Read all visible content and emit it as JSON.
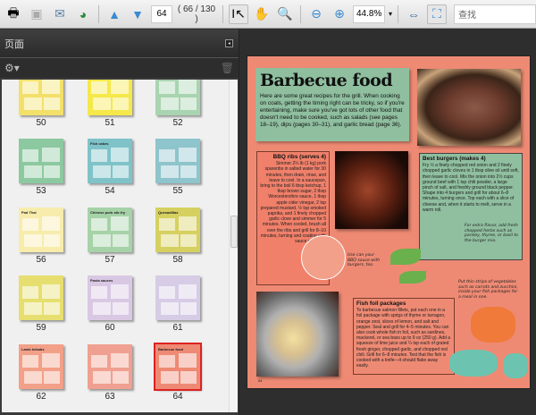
{
  "toolbar": {
    "page_input": "64",
    "page_count": "( 66 / 130 )",
    "zoom": "44.8%",
    "search_placeholder": "查找"
  },
  "panel": {
    "title": "页面"
  },
  "thumbnails": [
    {
      "label": "50",
      "color": "#f2e06a",
      "title": ""
    },
    {
      "label": "51",
      "color": "#f5e84a",
      "title": ""
    },
    {
      "label": "52",
      "color": "#a8d4b0",
      "title": ""
    },
    {
      "label": "53",
      "color": "#8cc9a0",
      "title": ""
    },
    {
      "label": "54",
      "color": "#7fc3c9",
      "title": "Fish cakes"
    },
    {
      "label": "55",
      "color": "#8ec4cc",
      "title": ""
    },
    {
      "label": "56",
      "color": "#f7ecac",
      "title": "Pad Thai"
    },
    {
      "label": "57",
      "color": "#a6d2a8",
      "title": "Chinese pork stir-fry"
    },
    {
      "label": "58",
      "color": "#d6d060",
      "title": "Quesadillas"
    },
    {
      "label": "59",
      "color": "#e6df70",
      "title": ""
    },
    {
      "label": "60",
      "color": "#d9c8e4",
      "title": "Pasta sauces"
    },
    {
      "label": "61",
      "color": "#d6cce6",
      "title": ""
    },
    {
      "label": "62",
      "color": "#f2a088",
      "title": "Lamb kebabs"
    },
    {
      "label": "63",
      "color": "#f0a090",
      "title": ""
    },
    {
      "label": "64",
      "color": "#ee8a74",
      "title": "Barbecue food",
      "selected": true
    }
  ],
  "document": {
    "title": "Barbecue food",
    "intro": "Here are some great recipes for the grill. When cooking on coals, getting the timing right can be tricky, so if you're entertaining, make sure you've got lots of other food that doesn't need to be cooked, such as salads (see pages 18–19), dips (pages 30–31), and garlic bread (page 36).",
    "ribs_title": "BBQ ribs (serves 4)",
    "ribs_text": "Simmer 2¼ lb (1 kg) pork spareribs in salted water for 30 minutes, then drain, rinse, and leave to cool. In a saucepan, bring to the boil 6 tbsp ketchup, 1 tbsp brown sugar, 2 tbsp Worcestershire sauce, 1 tbsp apple cider vinegar, 2 tsp prepared mustard, ½ tsp smoked paprika, and 1 finely chopped garlic clove and simmer for 5 minutes. When cooled, brush all over the ribs and grill for 8–10 minutes, turning and coating with sauce regularly.",
    "burgers_title": "Best burgers (makes 4)",
    "burgers_text": "Fry ½ a finely chopped red onion and 2 finely chopped garlic cloves in 1 tbsp olive oil until soft, then leave to cool. Mix the onion into 2½ cups ground beef with 1 tsp chili powder, a large pinch of salt, and freshly ground black pepper. Shape into 4 burgers and grill for about 6–8 minutes, turning once. Top each with a slice of cheese and, when it starts to melt, serve in a warm roll.",
    "fish_title": "Fish foil packages",
    "fish_text": "To barbecue salmon fillets, put each one in a foil package with sprigs of thyme or tarragon, orange zest, slices of lemon, and salt and pepper. Seal and grill for 4–5 minutes. You can also cook whole fish in foil, such as sardines, mackerel, or sea bass up to 9 oz (250 g). Add a squeeze of lime juice and ¼ tsp each of grated fresh ginger, chopped garlic, and chopped red chili. Grill for 6–8 minutes. Test that the fish is cooked with a knife—it should flake away easily.",
    "note_sauce": "Use can your BBQ sauce with burgers, too.",
    "note_herbs": "For extra flavor, add fresh chopped herbs such as parsley, thyme, or basil to the burger mix.",
    "note_veg": "Put thin strips of vegetables such as carrots and zucchini, inside your fish packages for a meal in one.",
    "page_number": "64"
  }
}
